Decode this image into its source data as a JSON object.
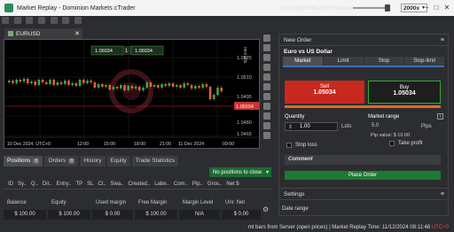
{
  "window": {
    "title": "Market Replay - Dominion Markets cTrader",
    "datetime": "11/12/2024 08:28:00",
    "speed_label": "Speed:",
    "speed_value": "2000x"
  },
  "chart_tab": {
    "symbol": "EURUSD"
  },
  "chart": {
    "prices": [
      "1.0525",
      "1.0510",
      "1.0495",
      "1.0480",
      "1.0465"
    ],
    "current_price": "1.05034",
    "xticks": [
      "10 Dec 2024, UTC+0",
      "12:00",
      "15:00",
      "18:00",
      "21:00",
      "11 Dec 2024",
      "09:00"
    ],
    "sell_chip": "1.05034",
    "buy_chip": "1.05034",
    "chip_s": "S",
    "chip_b": "B",
    "chip_one": "1",
    "units_label": "mini lots"
  },
  "bottom": {
    "tabs": [
      {
        "label": "Positions",
        "badge": "0"
      },
      {
        "label": "Orders",
        "badge": "0"
      },
      {
        "label": "History"
      },
      {
        "label": "Equity"
      },
      {
        "label": "Trade Statistics"
      }
    ],
    "no_positions": "No positions to close",
    "columns": [
      "ID",
      "Sy..",
      "Q..",
      "Dir..",
      "Entry..",
      "TP",
      "SL",
      "Cl..",
      "Swa..",
      "Created..",
      "Labe..",
      "Com..",
      "Pip..",
      "Gros..",
      "Net $"
    ],
    "account": [
      {
        "label": "Balance",
        "value": "$ 100.00"
      },
      {
        "label": "Equity",
        "value": "$ 100.00"
      },
      {
        "label": "Used margin",
        "value": "$ 0.00"
      },
      {
        "label": "Free Margin",
        "value": "$ 100.00"
      },
      {
        "label": "Margin Level",
        "value": "N/A"
      },
      {
        "label": "Unr. Net",
        "value": "$ 0.00"
      }
    ]
  },
  "order": {
    "header": "New Order",
    "symbol": "Euro vs US Dollar",
    "tabs": [
      "Market",
      "Limit",
      "Stop",
      "Stop-limit"
    ],
    "sell_label": "Sell",
    "sell_price": "1.05034",
    "buy_label": "Buy",
    "buy_price": "1.05034",
    "quantity_label": "Quantity",
    "quantity_value": "1.00",
    "lots_label": "Lots",
    "market_range_label": "Market range",
    "market_range_info": "i",
    "market_range_value": "5.0",
    "pips_label": "Pips",
    "pip_value": "Pip value: $ 10.00",
    "stop_loss": "Stop loss",
    "take_profit": "Take profit",
    "comment": "Comment",
    "place_order": "Place Order"
  },
  "settings": {
    "header": "Settings",
    "date_range": "Date range"
  },
  "status": {
    "text": "mt bars from Server (open prices)  |  Market Replay Time: ",
    "time": "11/12/2024 08:11:48",
    "tz": "UTC+0"
  },
  "colors": {
    "sell": "#c8281e",
    "buy_border": "#33aa33",
    "accent_orange": "#e06a1f",
    "place_order": "#1e7a32",
    "candle_up": "#3fa34d",
    "candle_down": "#e0603a"
  }
}
